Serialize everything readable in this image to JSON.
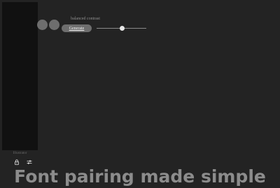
{
  "sidebar": {
    "caption": "Illustrator",
    "tools": [
      {
        "icon": "lock-icon"
      },
      {
        "icon": "sliders-icon"
      }
    ]
  },
  "controls": {
    "swatches": [
      {
        "color": "#6e6e6e"
      },
      {
        "color": "#6e6e6e"
      }
    ],
    "mode_label": "balanced contrast",
    "generate_label": "Generate",
    "slider_level_percent": 51
  },
  "hero": {
    "headline": "Font pairing made simple"
  },
  "colors": {
    "background": "#232323",
    "panel": "#111111",
    "control": "#6e6e6e",
    "headline": "#8c8c8c"
  }
}
